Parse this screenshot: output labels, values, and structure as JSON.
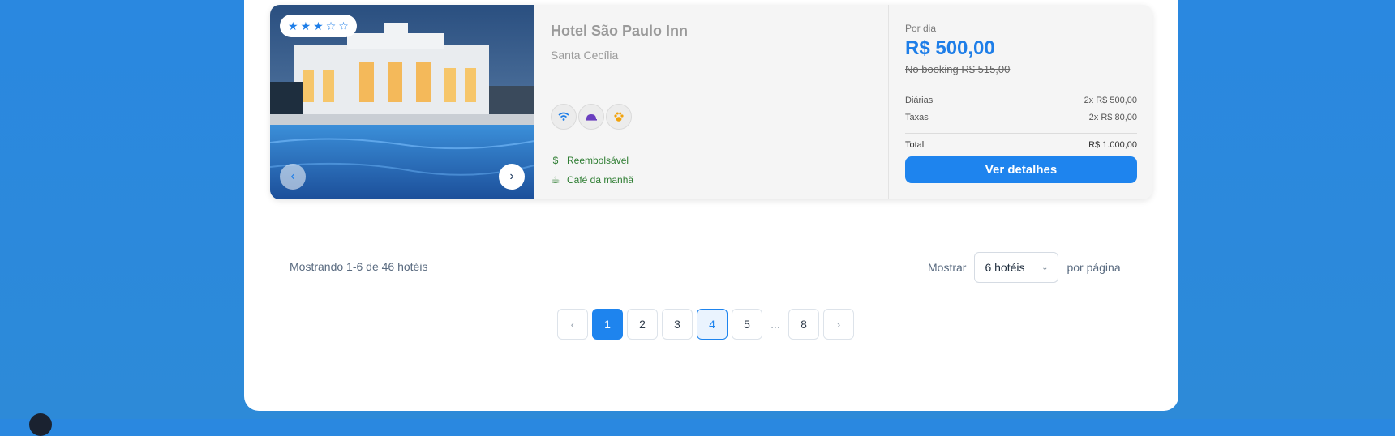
{
  "hotel": {
    "rating_stars": [
      "★",
      "★",
      "★",
      "☆",
      "☆"
    ],
    "rating": 3,
    "name": "Hotel São Paulo Inn",
    "neighborhood": "Santa Cecília",
    "amenities": [
      "wifi-icon",
      "room-service-icon",
      "pet-friendly-icon"
    ],
    "features": [
      {
        "icon": "$",
        "label": "Reembolsável"
      },
      {
        "icon": "☕",
        "label": "Café da manhã"
      }
    ]
  },
  "price": {
    "per_day_label": "Por dia",
    "amount": "R$ 500,00",
    "booking_compare": "No booking R$ 515,00",
    "rows": [
      {
        "label": "Diárias",
        "value": "2x R$ 500,00"
      },
      {
        "label": "Taxas",
        "value": "2x R$ 80,00"
      }
    ],
    "total_label": "Total",
    "total_value": "R$ 1.000,00",
    "cta": "Ver detalhes"
  },
  "results": {
    "showing": "Mostrando 1-6 de 46 hotéis",
    "show_label": "Mostrar",
    "per_page_value": "6 hotéis",
    "per_page_suffix": "por página"
  },
  "pagination": {
    "prev": "‹",
    "pages": [
      "1",
      "2",
      "3",
      "4",
      "5"
    ],
    "ellipsis": "...",
    "last": "8",
    "next": "›",
    "current": "1"
  },
  "colors": {
    "accent": "#1e84ee",
    "feature_green": "#2e7d32",
    "background": "#2b8be0"
  }
}
